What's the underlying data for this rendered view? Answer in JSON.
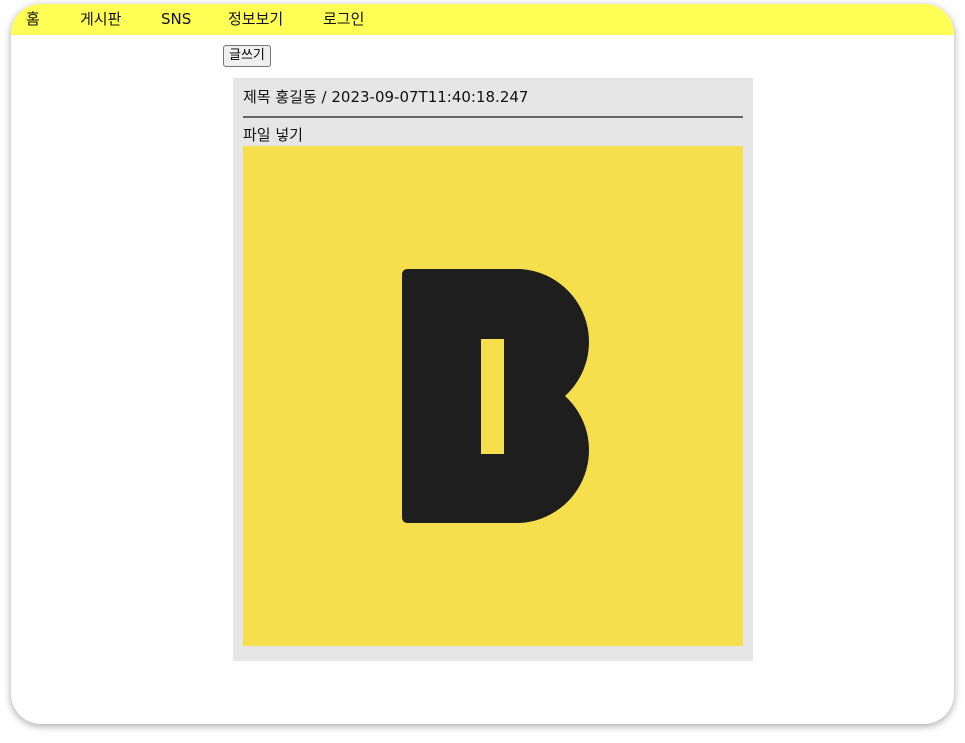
{
  "nav": {
    "home": "홈",
    "board": "게시판",
    "sns": "SNS",
    "info": "정보보기",
    "login": "로그인"
  },
  "toolbar": {
    "write_label": "글쓰기"
  },
  "post": {
    "title": "제목",
    "author": "홍길동",
    "datetime": "2023-09-07T11:40:18.247",
    "header_text": "제목 홍길동 / 2023-09-07T11:40:18.247",
    "body": "파일 넣기",
    "image_icon": "b-logo-icon"
  },
  "colors": {
    "navbar": "#ffff55",
    "card": "#e6e6e6",
    "image_bg": "#f5df4d",
    "logo": "#1e1e1e"
  }
}
